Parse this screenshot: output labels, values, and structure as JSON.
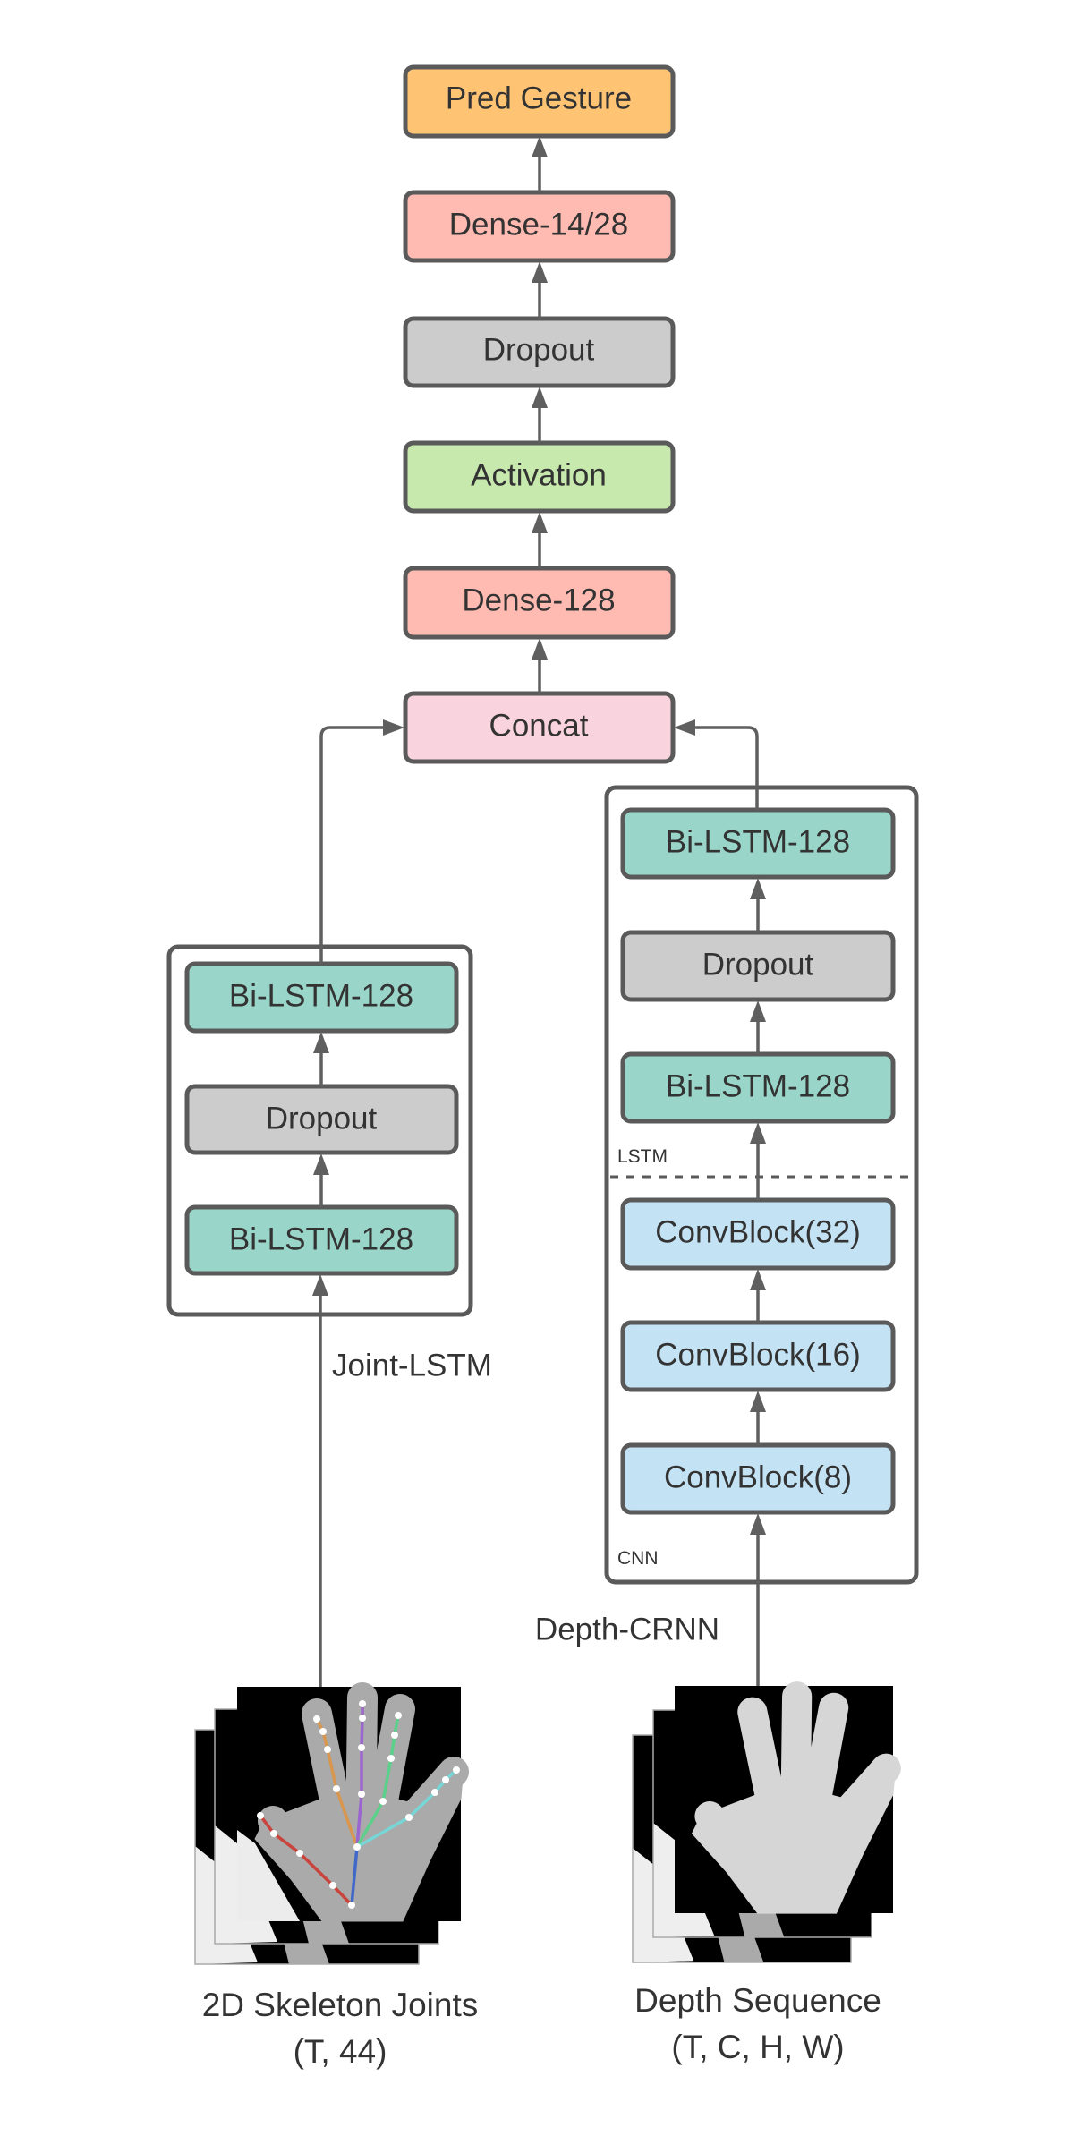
{
  "colors": {
    "output": "#ffc374",
    "dense": "#ffbbb1",
    "dropout": "#cccccc",
    "activation": "#c7e9ad",
    "concat": "#f9d3de",
    "lstm": "#99d6c9",
    "conv": "#c3e3f5",
    "border": "#5a5a5a"
  },
  "head": {
    "pred": "Pred Gesture",
    "dense_out": "Dense-14/28",
    "dropout": "Dropout",
    "activation": "Activation",
    "dense_128": "Dense-128",
    "concat": "Concat"
  },
  "joint_branch": {
    "name": "Joint-LSTM",
    "layers": [
      "Bi-LSTM-128",
      "Dropout",
      "Bi-LSTM-128"
    ],
    "input_label": "2D Skeleton Joints",
    "input_shape": "(T, 44)"
  },
  "depth_branch": {
    "name": "Depth-CRNN",
    "lstm_section": "LSTM",
    "cnn_section": "CNN",
    "lstm_layers": [
      "Bi-LSTM-128",
      "Dropout",
      "Bi-LSTM-128"
    ],
    "cnn_layers": [
      "ConvBlock(32)",
      "ConvBlock(16)",
      "ConvBlock(8)"
    ],
    "input_label": "Depth Sequence",
    "input_shape": "(T, C, H, W)"
  }
}
